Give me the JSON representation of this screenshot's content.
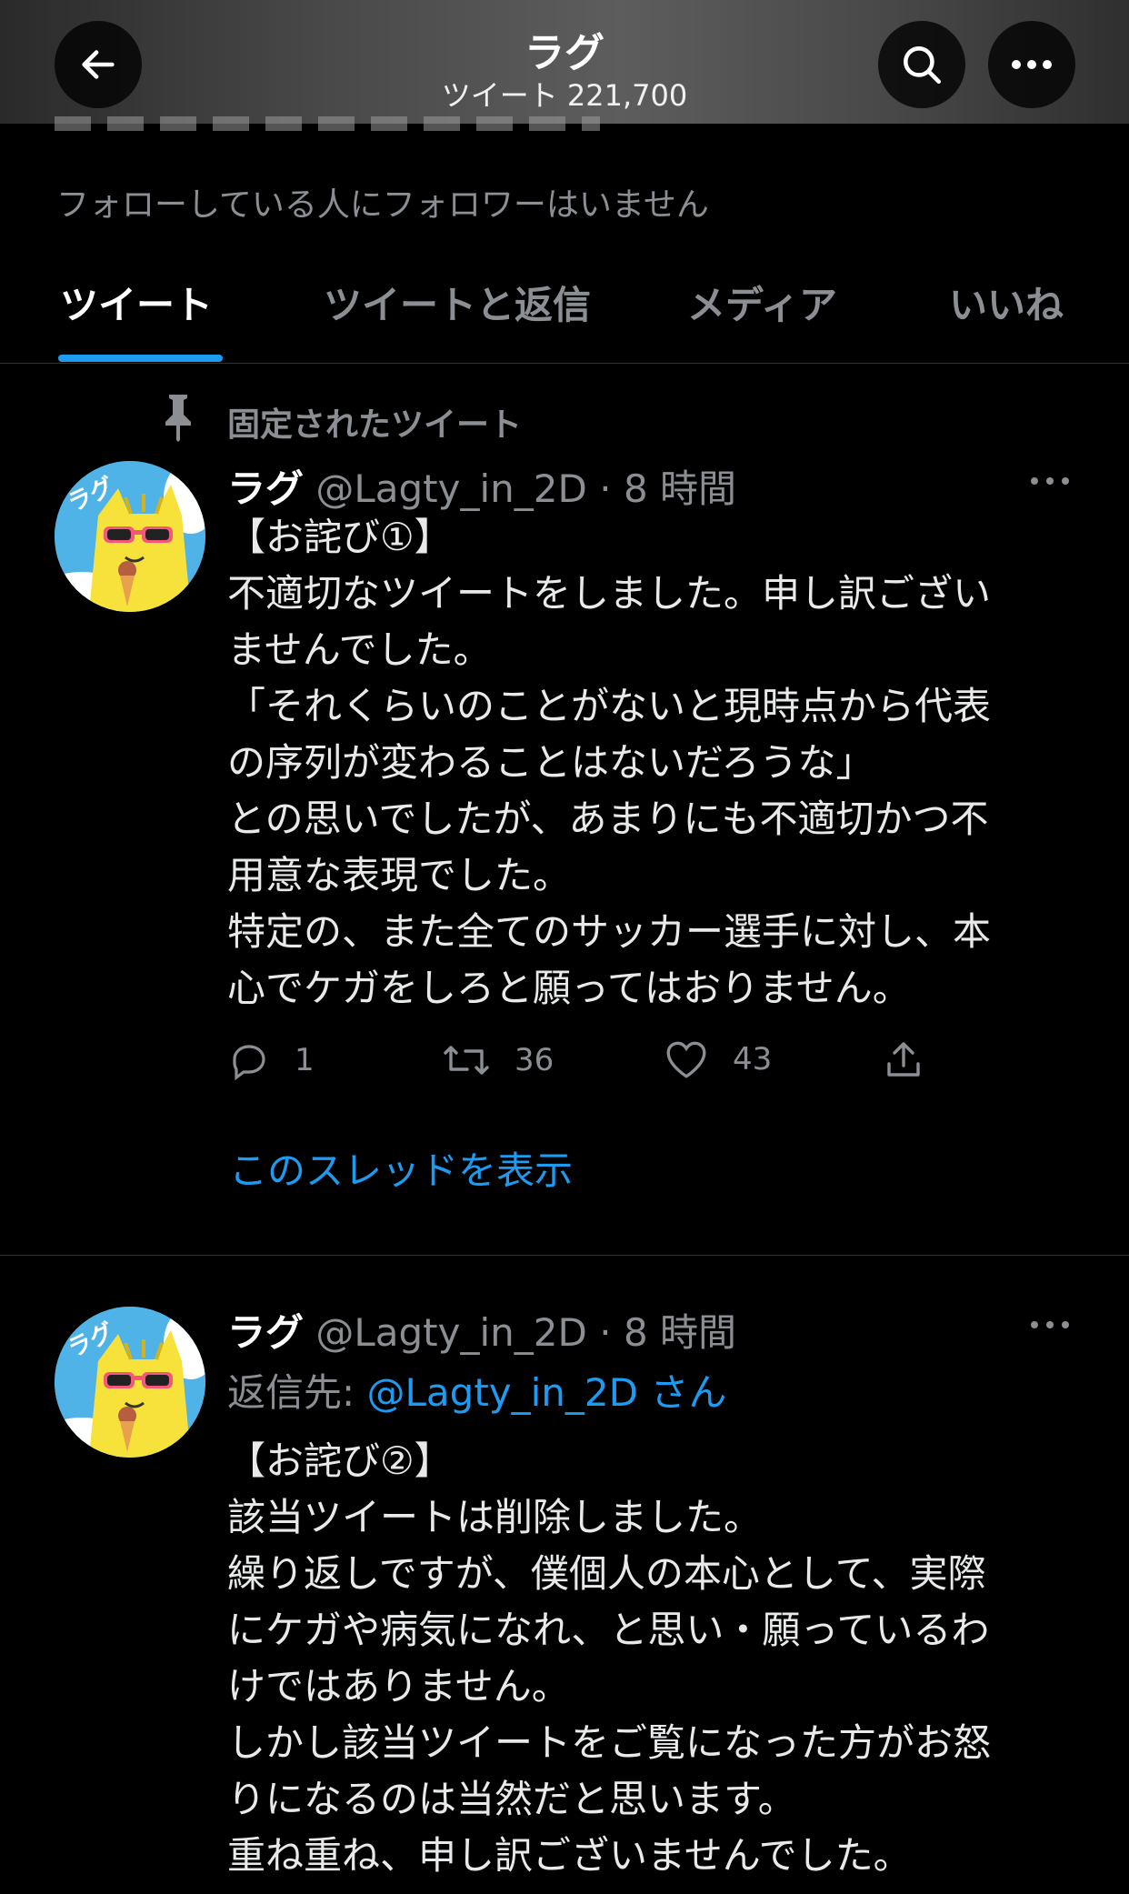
{
  "header": {
    "title": "ラグ",
    "subtitle": "ツイート 221,700"
  },
  "profile": {
    "no_followers_text": "フォローしている人にフォロワーはいません"
  },
  "tabs": [
    {
      "label": "ツイート",
      "active": true
    },
    {
      "label": "ツイートと返信",
      "active": false
    },
    {
      "label": "メディア",
      "active": false
    },
    {
      "label": "いいね",
      "active": false
    }
  ],
  "pinned_label": "固定されたツイート",
  "tweets": [
    {
      "name": "ラグ",
      "handle": "@Lagty_in_2D",
      "dot": "·",
      "time": "8 時間",
      "body": "【お詫び①】\n不適切なツイートをしました。申し訳ござい\nませんでした。\n「それくらいのことがないと現時点から代表\nの序列が変わることはないだろうな」\nとの思いでしたが、あまりにも不適切かつ不\n用意な表現でした。\n特定の、また全てのサッカー選手に対し、本\n心でケガをしろと願ってはおりません。",
      "replies": "1",
      "retweets": "36",
      "likes": "43",
      "show_thread": "このスレッドを表示"
    },
    {
      "name": "ラグ",
      "handle": "@Lagty_in_2D",
      "dot": "·",
      "time": "8 時間",
      "reply_prefix": "返信先: ",
      "reply_handle": "@Lagty_in_2D",
      "reply_suffix": " さん",
      "body": "【お詫び②】\n該当ツイートは削除しました。\n繰り返しですが、僕個人の本心として、実際\nにケガや病気になれ、と思い・願っているわ\nけではありません。\nしかし該当ツイートをご覧になった方がお怒\nりになるのは当然だと思います。\n重ね重ね、申し訳ございませんでした。"
    }
  ],
  "avatar": {
    "badge_text": "ラグ"
  },
  "colors": {
    "background": "#000000",
    "accent": "#1d9bf0",
    "secondary_text": "#8b8f94",
    "primary_text": "#e7e9ea"
  }
}
